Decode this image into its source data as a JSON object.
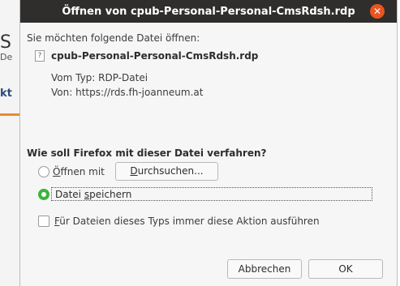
{
  "background": {
    "frag1": "S",
    "frag2": "De",
    "frag3": "kt"
  },
  "dialog": {
    "title": "Öffnen von cpub-Personal-Personal-CmsRdsh.rdp",
    "close_glyph": "✕",
    "intro": "Sie möchten folgende Datei öffnen:",
    "file_icon_glyph": "?",
    "filename": "cpub-Personal-Personal-CmsRdsh.rdp",
    "type_line": "Vom Typ: RDP-Datei",
    "from_line": "Von: https://rds.fh-joanneum.at",
    "question": "Wie soll Firefox mit dieser Datei verfahren?",
    "open_with": {
      "mnemonic": "Ö",
      "rest": "ffnen mit"
    },
    "browse": {
      "mnemonic": "D",
      "rest": "urchsuchen..."
    },
    "save": {
      "prefix": "Datei ",
      "mnemonic": "s",
      "rest": "peichern"
    },
    "always": {
      "mnemonic": "F",
      "rest": "ür Dateien dieses Typs immer diese Aktion ausführen"
    },
    "cancel_label": "Abbrechen",
    "ok_label": "OK"
  },
  "colors": {
    "titlebar": "#2f2e2c",
    "close": "#e95420",
    "radio_selected": "#3cb43c"
  }
}
